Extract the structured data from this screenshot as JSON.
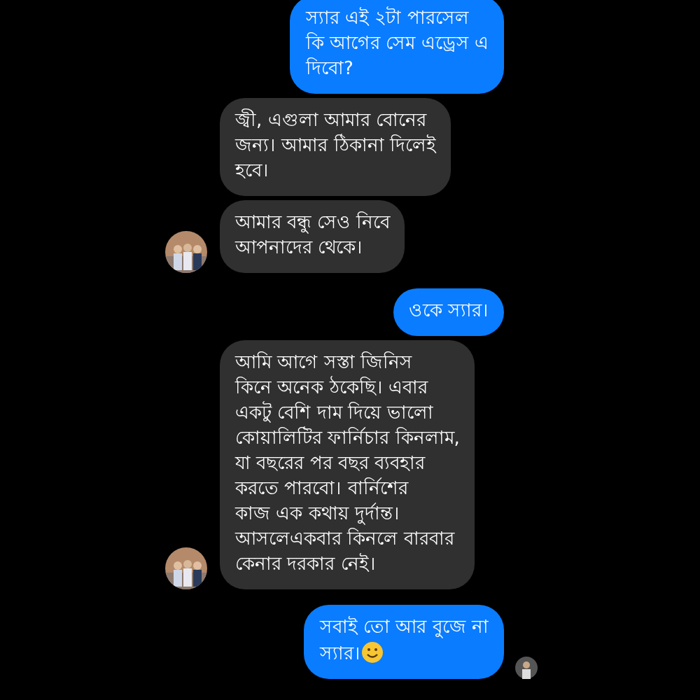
{
  "messages": [
    {
      "kind": "sent",
      "lines": [
        "স্যার এই ২টা পারসেল",
        "কি আগের সেম এড্রেস এ",
        "দিবো?"
      ]
    },
    {
      "kind": "received",
      "lines": [
        "জ্বী, এগুলা আমার বোনের",
        "জন্য। আমার ঠিকানা দিলেই",
        "হবে।"
      ]
    },
    {
      "kind": "received",
      "avatar": true,
      "lines": [
        "আমার বন্ধু সেও নিবে",
        "আপনাদের থেকে।"
      ]
    },
    {
      "kind": "sent",
      "lines": [
        "ওকে স্যার।"
      ]
    },
    {
      "kind": "received",
      "avatar": true,
      "lines": [
        "আমি আগে সস্তা জিনিস",
        "কিনে অনেক ঠকেছি। এবার",
        "একটু বেশি দাম দিয়ে ভালো",
        "কোয়ালিটির ফার্নিচার কিনলাম,",
        "যা বছরের পর বছর ব্যবহার",
        "করতে পারবো। বার্নিশের",
        "কাজ এক কথায় দুর্দান্ত।",
        "আসলেএকবার কিনলে বারবার",
        "কেনার দরকার নেই।"
      ]
    },
    {
      "kind": "sent",
      "emoji": true,
      "seen": true,
      "lines": [
        "সবাই তো আর বুজে না",
        "স্যার।"
      ]
    }
  ]
}
